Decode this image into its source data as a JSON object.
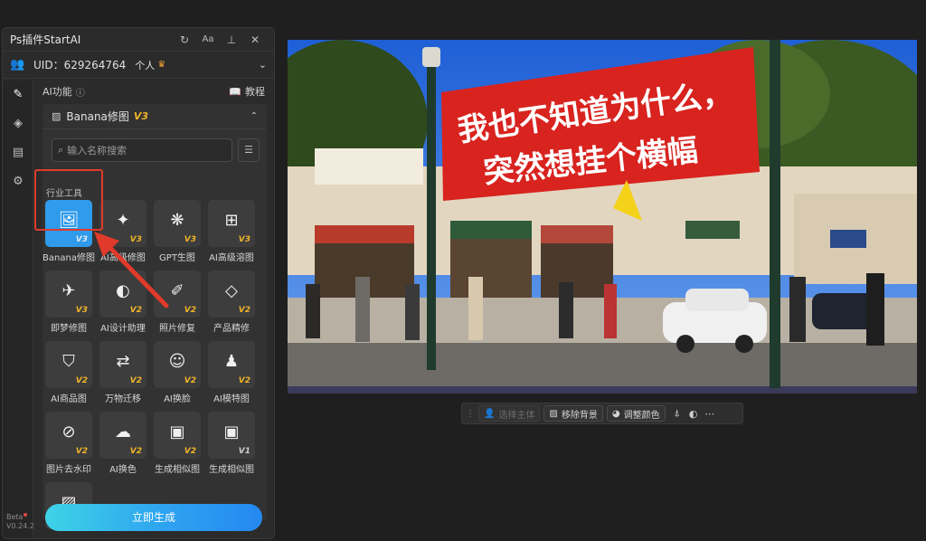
{
  "panel": {
    "title": "Ps插件StartAI",
    "title_icons": [
      "refresh-icon",
      "font-size-icon",
      "pin-icon",
      "close-icon"
    ],
    "title_glyphs": [
      "↻",
      "Aa",
      "⊥",
      "✕"
    ],
    "uid_text": "UID：629264764",
    "tier": "个人",
    "crown": "♛"
  },
  "nav": {
    "items": [
      {
        "icon": "edit-icon",
        "glyph": "✎"
      },
      {
        "icon": "layers-icon",
        "glyph": "◈"
      },
      {
        "icon": "document-icon",
        "glyph": "▤"
      },
      {
        "icon": "settings-icon",
        "glyph": "⚙"
      }
    ],
    "beta_label": "Beta",
    "version": "V0.24.2"
  },
  "section": {
    "label": "AI功能",
    "tutorial": "教程"
  },
  "toolcard": {
    "name": "Banana修图",
    "version": "V3"
  },
  "search": {
    "placeholder": "输入名称搜索"
  },
  "category": "行业工具",
  "tools": [
    {
      "label": "Banana修图",
      "glyph": "🖼",
      "ver": "V3",
      "selected": true
    },
    {
      "label": "AI高级修图",
      "glyph": "✦",
      "ver": "V3"
    },
    {
      "label": "GPT生图",
      "glyph": "❋",
      "ver": "V3"
    },
    {
      "label": "AI高级溶图",
      "glyph": "⊞",
      "ver": "V3"
    },
    {
      "label": "即梦修图",
      "glyph": "✈",
      "ver": "V3"
    },
    {
      "label": "AI设计助理",
      "glyph": "◐",
      "ver": "V2"
    },
    {
      "label": "照片修复",
      "glyph": "✐",
      "ver": "V2"
    },
    {
      "label": "产品精修",
      "glyph": "◇",
      "ver": "V2"
    },
    {
      "label": "AI商品图",
      "glyph": "⛉",
      "ver": "V2"
    },
    {
      "label": "万物迁移",
      "glyph": "⇄",
      "ver": "V2"
    },
    {
      "label": "AI换脸",
      "glyph": "☺",
      "ver": "V2"
    },
    {
      "label": "AI模特图",
      "glyph": "♟",
      "ver": "V2"
    },
    {
      "label": "图片去水印",
      "glyph": "⊘",
      "ver": "V2"
    },
    {
      "label": "AI换色",
      "glyph": "☁",
      "ver": "V2"
    },
    {
      "label": "生成相似图",
      "glyph": "▣",
      "ver": "V2"
    },
    {
      "label": "生成相似图",
      "glyph": "▣",
      "ver": "V1"
    },
    {
      "label": "",
      "glyph": "▨",
      "ver": "V1"
    }
  ],
  "generate_button": "立即生成",
  "photo": {
    "banner_line1": "我也不知道为什么，",
    "banner_line2": "突然想挂个横幅",
    "banner_color": "#d8231f"
  },
  "ctxbar": {
    "select_subject": "选择主体",
    "remove_bg": "移除背景",
    "adjust_color": "调整颜色",
    "icons": [
      "brush-icon",
      "contrast-icon",
      "more-icon"
    ]
  },
  "colors": {
    "accent": "#2f9bea",
    "version_badge": "#f0b429",
    "highlight": "#e03a2a"
  }
}
